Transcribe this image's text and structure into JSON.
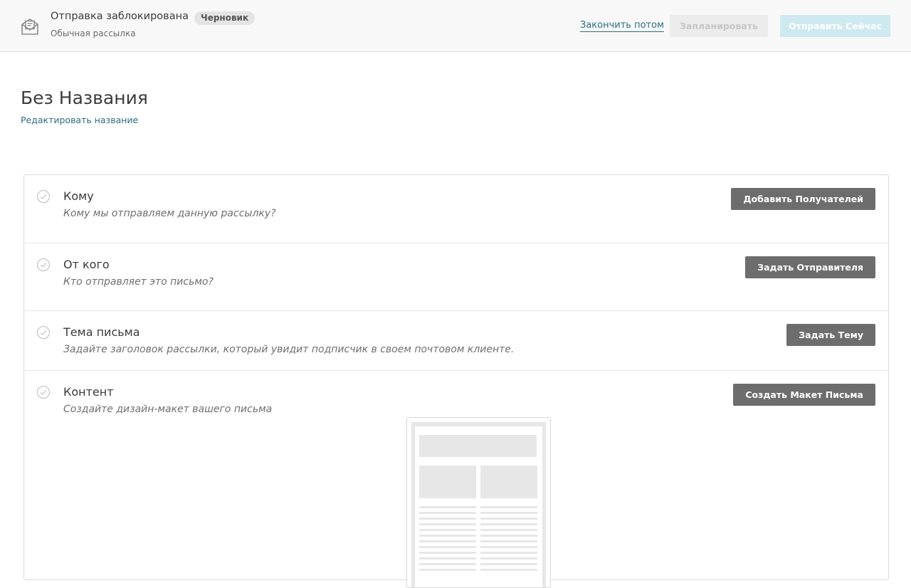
{
  "header": {
    "status_title": "Отправка заблокирована",
    "status_badge": "Черновик",
    "campaign_type": "Обычная рассылка",
    "icon": "envelope-icon",
    "finish_later_label": "Закончить потом",
    "schedule_label": "Запланировать",
    "send_now_label": "Отправить Сейчас"
  },
  "page": {
    "title": "Без Названия",
    "edit_title_label": "Редактировать название"
  },
  "checklist": [
    {
      "title": "Кому",
      "description": "Кому мы отправляем данную рассылку?",
      "button": "Добавить Получателей",
      "checked": false
    },
    {
      "title": "От кого",
      "description": "Кто отправляет это письмо?",
      "button": "Задать Отправителя",
      "checked": false
    },
    {
      "title": "Тема письма",
      "description": "Задайте заголовок рассылки, который увидит подписчик в своем почтовом клиенте.",
      "button": "Задать Тему",
      "checked": false
    },
    {
      "title": "Контент",
      "description": "Создайте дизайн-макет вашего письма",
      "button": "Создать Макет Письма",
      "checked": false
    }
  ],
  "colors": {
    "accent_link": "#2c6e82",
    "primary_disabled": "#cfe9f1",
    "secondary_disabled": "#ececec",
    "row_button": "#6d6d6d"
  }
}
